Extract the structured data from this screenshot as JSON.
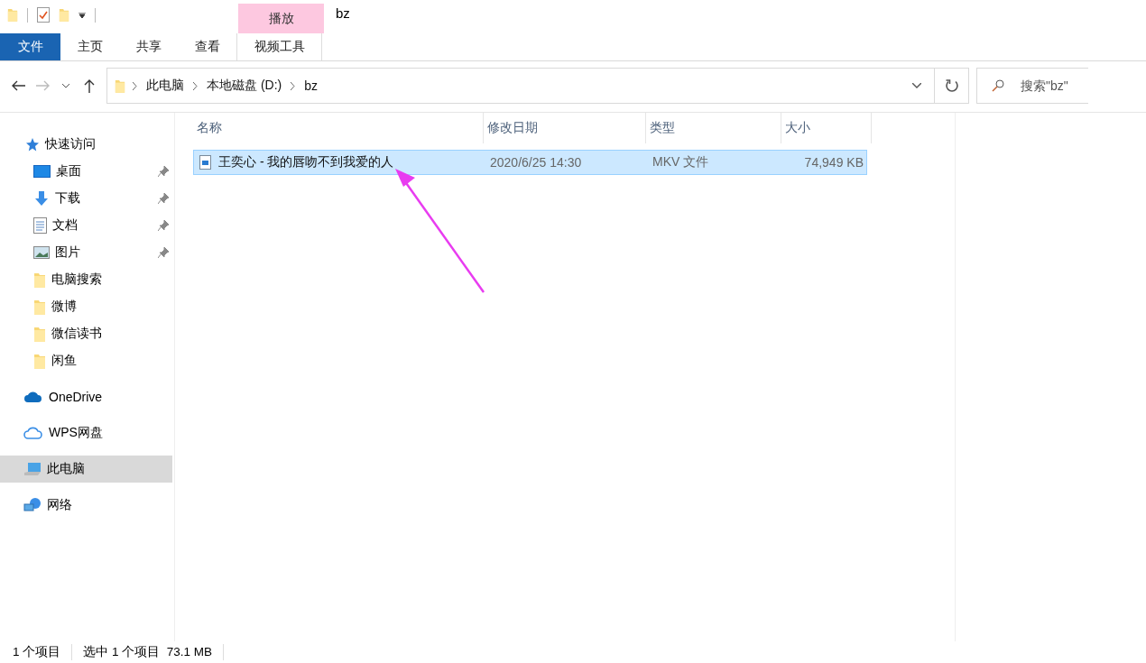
{
  "window": {
    "title": "bz"
  },
  "ribbon": {
    "context_label": "播放",
    "tabs": [
      {
        "label": "文件",
        "kind": "file",
        "selected": false
      },
      {
        "label": "主页",
        "kind": "tab",
        "selected": false
      },
      {
        "label": "共享",
        "kind": "tab",
        "selected": false
      },
      {
        "label": "查看",
        "kind": "tab",
        "selected": false
      },
      {
        "label": "视频工具",
        "kind": "context",
        "selected": false
      }
    ]
  },
  "address": {
    "crumbs": [
      "此电脑",
      "本地磁盘 (D:)",
      "bz"
    ]
  },
  "search": {
    "placeholder": "搜索\"bz\""
  },
  "sidebar": {
    "items": [
      {
        "label": "快速访问",
        "kind": "quick",
        "pinned": false,
        "selected": false
      },
      {
        "label": "桌面",
        "kind": "desktop",
        "pinned": true,
        "selected": false
      },
      {
        "label": "下载",
        "kind": "download",
        "pinned": true,
        "selected": false
      },
      {
        "label": "文档",
        "kind": "document",
        "pinned": true,
        "selected": false
      },
      {
        "label": "图片",
        "kind": "pictures",
        "pinned": true,
        "selected": false
      },
      {
        "label": "电脑搜索",
        "kind": "folder",
        "pinned": false,
        "selected": false
      },
      {
        "label": "微博",
        "kind": "folder",
        "pinned": false,
        "selected": false
      },
      {
        "label": "微信读书",
        "kind": "folder",
        "pinned": false,
        "selected": false
      },
      {
        "label": "闲鱼",
        "kind": "folder",
        "pinned": false,
        "selected": false
      },
      {
        "label": "OneDrive",
        "kind": "onedrive",
        "pinned": false,
        "selected": false
      },
      {
        "label": "WPS网盘",
        "kind": "wps",
        "pinned": false,
        "selected": false
      },
      {
        "label": "此电脑",
        "kind": "pc",
        "pinned": false,
        "selected": true
      },
      {
        "label": "网络",
        "kind": "network",
        "pinned": false,
        "selected": false
      }
    ]
  },
  "table": {
    "columns": [
      "名称",
      "修改日期",
      "类型",
      "大小"
    ],
    "rows": [
      {
        "cells": [
          "王奕心 - 我的唇吻不到我爱的人",
          "2020/6/25 14:30",
          "MKV 文件",
          "74,949 KB"
        ],
        "selected": true
      }
    ]
  },
  "status_bar": {
    "count": "1 个项目",
    "selection": "选中 1 个项目  73.1 MB"
  }
}
